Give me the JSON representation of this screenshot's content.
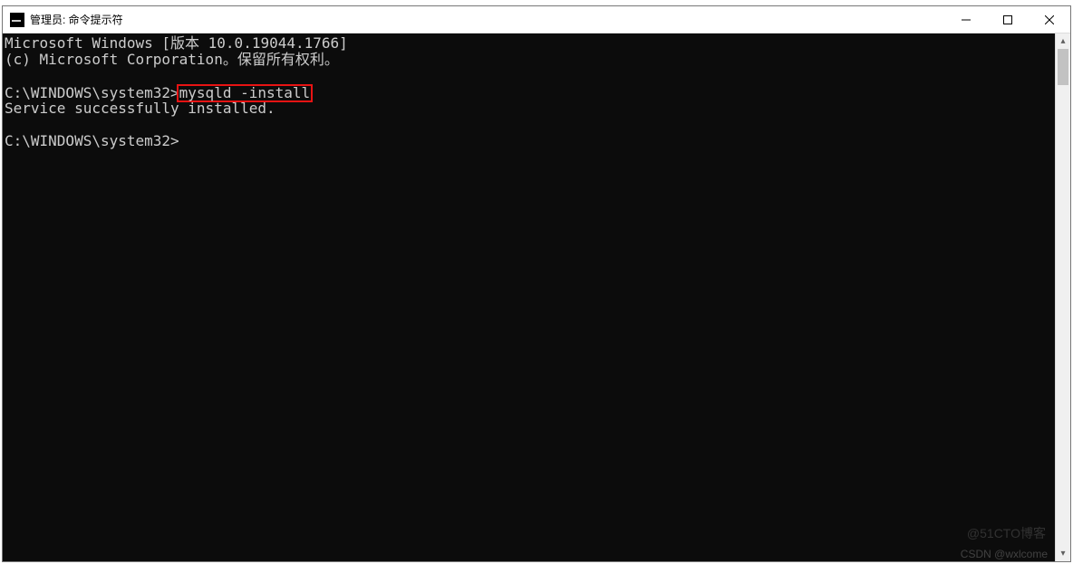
{
  "window": {
    "title": "管理员: 命令提示符"
  },
  "terminal": {
    "line1": "Microsoft Windows [版本 10.0.19044.1766]",
    "line2": "(c) Microsoft Corporation。保留所有权利。",
    "blank": "",
    "prompt1_prefix": "C:\\WINDOWS\\system32>",
    "prompt1_command": "mysqld -install",
    "result1": "Service successfully installed.",
    "prompt2": "C:\\WINDOWS\\system32>"
  },
  "watermark": "CSDN @wxlcome",
  "watermark2": "@51CTO博客"
}
